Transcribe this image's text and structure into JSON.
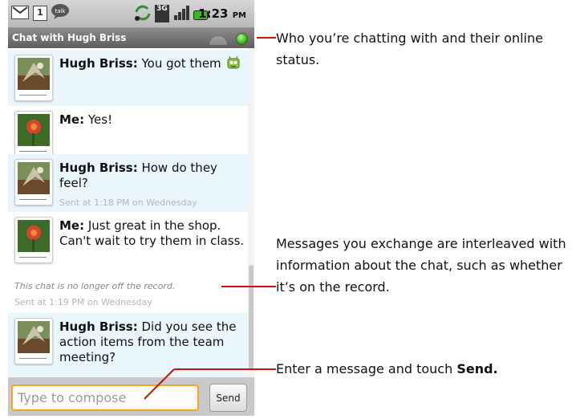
{
  "status_bar": {
    "talk_label": "talk",
    "calendar_day": "1",
    "network": "3G",
    "time": "1:23",
    "time_suffix": "PM"
  },
  "title_bar": {
    "title": "Chat with Hugh Briss",
    "presence_color": "#38b51c"
  },
  "messages": [
    {
      "sender": "Hugh Briss:",
      "text": " You got them",
      "emoticon": "robot-smiley-icon",
      "timestamp": ""
    },
    {
      "sender": "Me:",
      "text": " Yes!",
      "timestamp": ""
    },
    {
      "sender": "Hugh Briss:",
      "text": " How do they feel?",
      "timestamp": "Sent at 1:18 PM on Wednesday"
    },
    {
      "sender": "Me:",
      "text": " Just great in the shop. Can't wait to try them in class.",
      "timestamp": ""
    },
    {
      "sender": "Hugh Briss:",
      "text": " Did you see the action items from the team meeting?",
      "timestamp": ""
    }
  ],
  "system_note": {
    "text": "This chat is no longer off the record.",
    "timestamp": "Sent at 1:19 PM on Wednesday"
  },
  "compose": {
    "placeholder": "Type to compose",
    "send_label": "Send"
  },
  "annotations": {
    "header": "Who you’re chatting with and their online status.",
    "messages": "Messages you exchange are interleaved with information about the chat, such as whether it’s on the record.",
    "compose_prefix": "Enter a message and touch ",
    "compose_bold": "Send."
  },
  "colors": {
    "callout": "#cc1111",
    "incoming_bg": "#e9f6fc",
    "compose_border": "#f6a523"
  }
}
